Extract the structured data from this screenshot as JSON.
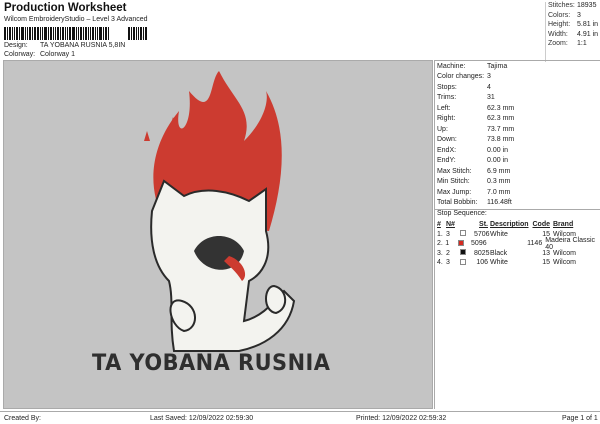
{
  "header": {
    "title": "Production Worksheet",
    "subtitle": "Wilcom EmbroideryStudio – Level 3 Advanced",
    "barcode_suffix": ",",
    "design_label": "Design:",
    "design": "TA YOBANA RUSNIA 5,8IN",
    "colorway_label": "Colorway:",
    "colorway": "Colorway 1"
  },
  "stats": [
    {
      "k": "Stitches:",
      "v": "18935"
    },
    {
      "k": "Colors:",
      "v": "3"
    },
    {
      "k": "Height:",
      "v": "5.81 in"
    },
    {
      "k": "Width:",
      "v": "4.91 in"
    },
    {
      "k": "Zoom:",
      "v": "1:1"
    }
  ],
  "info": [
    {
      "k": "Machine:",
      "v": "Tajima"
    },
    {
      "k": "Color changes:",
      "v": "3"
    },
    {
      "k": "Stops:",
      "v": "4"
    },
    {
      "k": "Trims:",
      "v": "31"
    },
    {
      "k": "Left:",
      "v": "62.3 mm"
    },
    {
      "k": "Right:",
      "v": "62.3 mm"
    },
    {
      "k": "Up:",
      "v": "73.7 mm"
    },
    {
      "k": "Down:",
      "v": "73.8 mm"
    },
    {
      "k": "EndX:",
      "v": "0.00 in"
    },
    {
      "k": "EndY:",
      "v": "0.00 in"
    },
    {
      "k": "Max Stitch:",
      "v": "6.9 mm"
    },
    {
      "k": "Min Stitch:",
      "v": "0.3 mm"
    },
    {
      "k": "Max Jump:",
      "v": "7.0 mm"
    },
    {
      "k": "Total Bobbin:",
      "v": "116.48ft"
    }
  ],
  "stop_sequence": {
    "title": "Stop Sequence:",
    "headers": [
      "#",
      "N#",
      "",
      "St.",
      "Description",
      "Code",
      "Brand"
    ],
    "rows": [
      {
        "n": "1.",
        "num": "3",
        "color": "#ffffff",
        "st": "5706",
        "desc": "White",
        "code": "15",
        "brand": "Wilcom"
      },
      {
        "n": "2.",
        "num": "1",
        "color": "#d42a20",
        "st": "5096",
        "desc": "",
        "code": "1146",
        "brand": "Madeira Classic 40"
      },
      {
        "n": "3.",
        "num": "2",
        "color": "#111111",
        "st": "8025",
        "desc": "Black",
        "code": "13",
        "brand": "Wilcom"
      },
      {
        "n": "4.",
        "num": "3",
        "color": "#ffffff",
        "st": "106",
        "desc": "White",
        "code": "15",
        "brand": "Wilcom"
      }
    ]
  },
  "design_text": "TA YOBANA RUSNIA",
  "footer": {
    "created": "Created By:",
    "saved": "Last Saved:  12/09/2022 02:59:30",
    "printed": "Printed:  12/09/2022 02:59:32",
    "page": "Page 1 of 1"
  }
}
